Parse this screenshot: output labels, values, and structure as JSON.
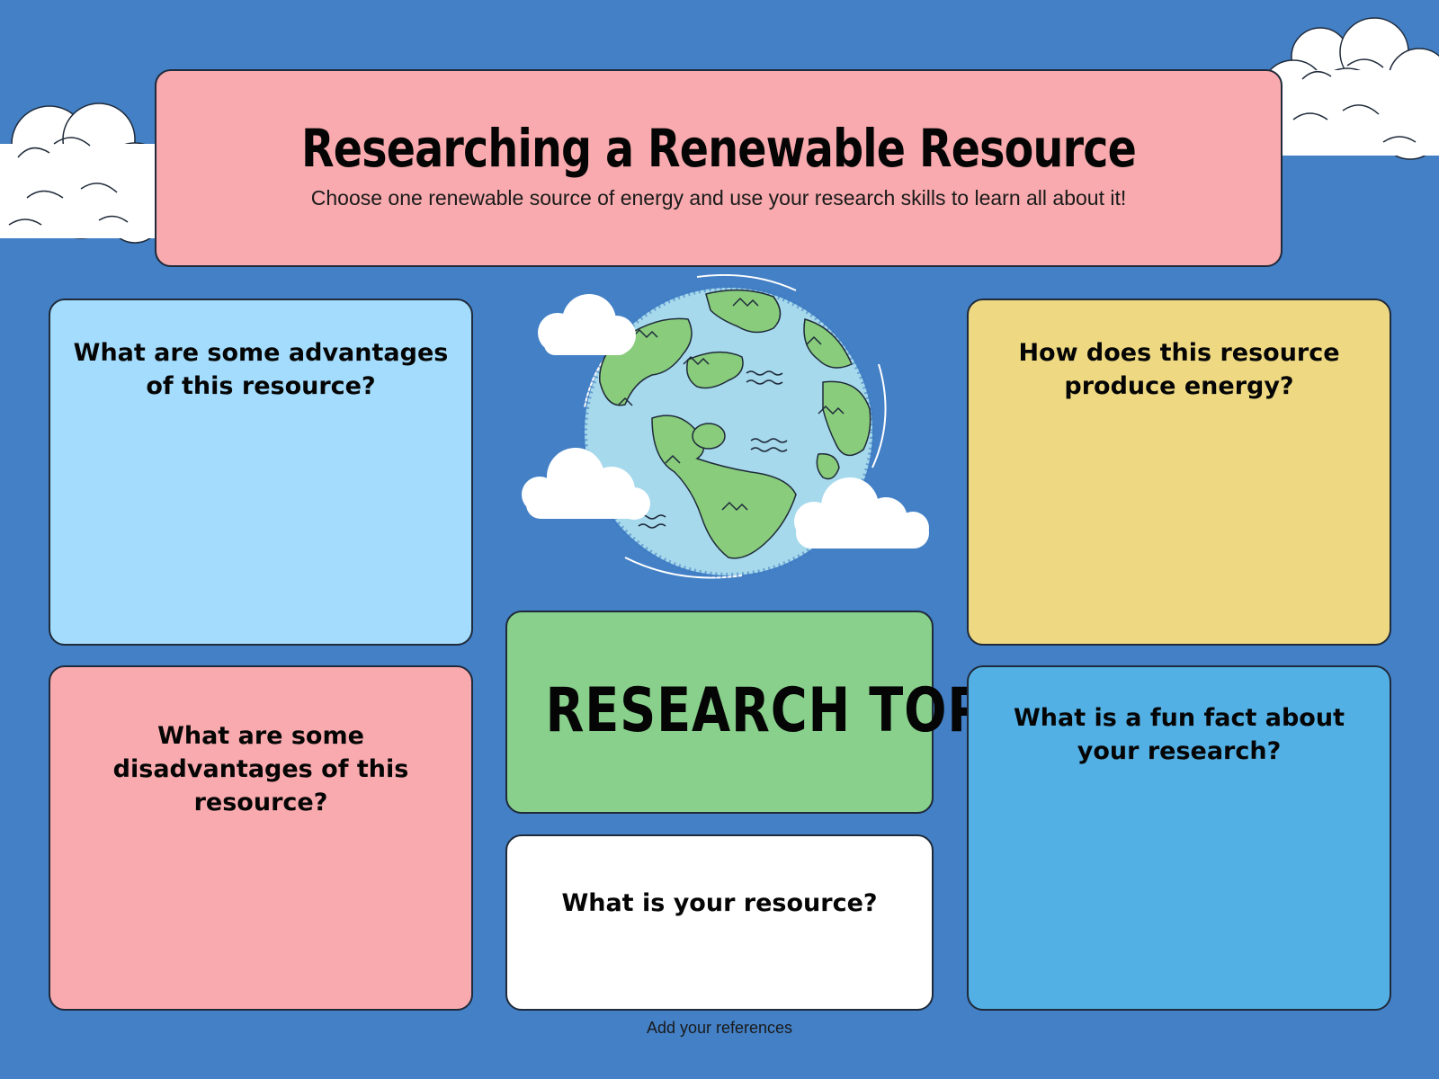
{
  "header": {
    "title": "Researching a Renewable Resource",
    "subtitle": "Choose one renewable source of energy and use your research skills to learn all about it!"
  },
  "boxes": {
    "advantages": "What are some advantages of this resource?",
    "produce": "How does this resource produce energy?",
    "disadvantages": "What are some disadvantages of this resource?",
    "topic": "RESEARCH TOPIC",
    "resource": "What is your resource?",
    "funfact": "What is a fun fact about your research?"
  },
  "footer": {
    "references": "Add your references"
  },
  "colors": {
    "background": "#4380c6",
    "header": "#f8aaae",
    "advantages": "#a3dcfc",
    "produce": "#eed982",
    "disadvantages": "#f8aaae",
    "topic": "#88d08c",
    "resource": "#ffffff",
    "funfact": "#53b0e4"
  },
  "icons": [
    "cloud-icon",
    "globe-icon"
  ]
}
